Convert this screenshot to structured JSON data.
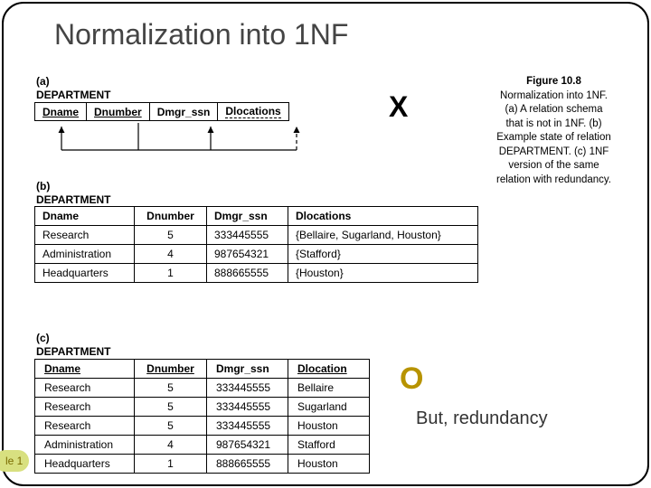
{
  "title": "Normalization into 1NF",
  "figure": {
    "title": "Figure 10.8",
    "lines": [
      "Normalization into 1NF.",
      "(a) A relation schema",
      "that is not in 1NF. (b)",
      "Example state of relation",
      "DEPARTMENT. (c) 1NF",
      "version of the same",
      "relation with redundancy."
    ]
  },
  "labels": {
    "a": "(a)",
    "b": "(b)",
    "c": "(c)",
    "dept": "DEPARTMENT"
  },
  "tableA": {
    "cols": [
      "Dname",
      "Dnumber",
      "Dmgr_ssn",
      "Dlocations"
    ]
  },
  "tableB": {
    "cols": [
      "Dname",
      "Dnumber",
      "Dmgr_ssn",
      "Dlocations"
    ],
    "rows": [
      [
        "Research",
        "5",
        "333445555",
        "{Bellaire, Sugarland, Houston}"
      ],
      [
        "Administration",
        "4",
        "987654321",
        "{Stafford}"
      ],
      [
        "Headquarters",
        "1",
        "888665555",
        "{Houston}"
      ]
    ]
  },
  "tableC": {
    "cols": [
      "Dname",
      "Dnumber",
      "Dmgr_ssn",
      "Dlocation"
    ],
    "rows": [
      [
        "Research",
        "5",
        "333445555",
        "Bellaire"
      ],
      [
        "Research",
        "5",
        "333445555",
        "Sugarland"
      ],
      [
        "Research",
        "5",
        "333445555",
        "Houston"
      ],
      [
        "Administration",
        "4",
        "987654321",
        "Stafford"
      ],
      [
        "Headquarters",
        "1",
        "888665555",
        "Houston"
      ]
    ]
  },
  "marks": {
    "x": "X",
    "o": "O",
    "note": "But, redundancy"
  },
  "page_badge": "le 1"
}
